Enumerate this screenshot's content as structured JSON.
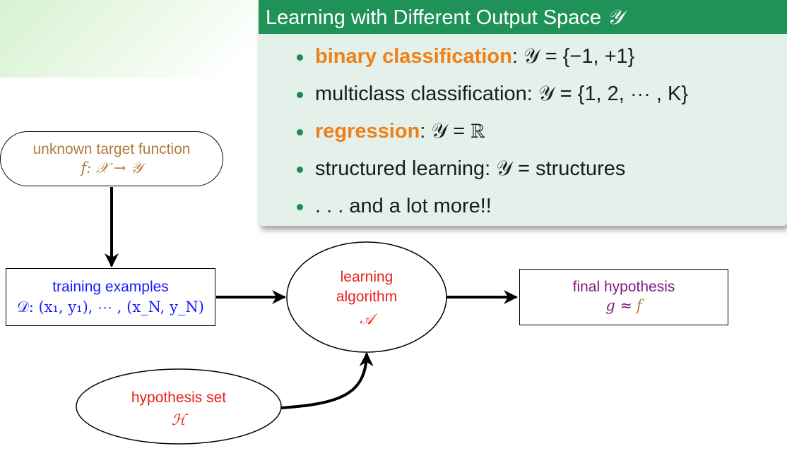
{
  "callout": {
    "title": "Learning with Different Output Space",
    "title_symbol": "𝒴",
    "bullets": [
      {
        "highlight": "binary classification",
        "text": ": 𝒴 = {−1, +1}"
      },
      {
        "highlight": "",
        "text": "multiclass classification: 𝒴 = {1, 2, ⋯ , K}"
      },
      {
        "highlight": "regression",
        "text": ": 𝒴 = ℝ"
      },
      {
        "highlight": "",
        "text": "structured learning: 𝒴 = structures"
      },
      {
        "highlight": "",
        "text": ". . . and a lot more!!"
      }
    ]
  },
  "nodes": {
    "target": {
      "label": "unknown target function",
      "math": "f: 𝒳 → 𝒴"
    },
    "training": {
      "label": "training examples",
      "math": "𝒟: (x₁, y₁), ⋯ , (x_N, y_N)"
    },
    "algorithm": {
      "label_line1": "learning",
      "label_line2": "algorithm",
      "math": "𝒜"
    },
    "final": {
      "label": "final hypothesis",
      "math_g": "g ≈",
      "math_f": "f"
    },
    "hypothesis_set": {
      "label": "hypothesis set",
      "math": "ℋ"
    }
  },
  "colors": {
    "header_green": "#1f9258",
    "callout_bg": "#e4f1ea",
    "highlight_orange": "#f07f15",
    "target_brown": "#b07d3e",
    "training_blue": "#1a1aff",
    "algorithm_red": "#e8201a",
    "final_purple": "#7d1b7e"
  }
}
